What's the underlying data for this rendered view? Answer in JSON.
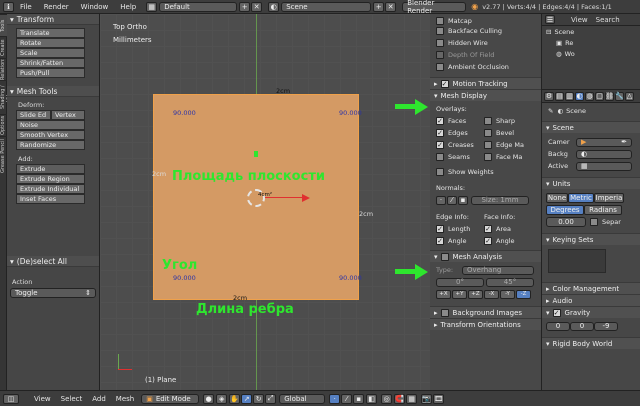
{
  "topbar": {
    "menus": [
      "File",
      "Render",
      "Window",
      "Help"
    ],
    "screen_layout": "Default",
    "scene": "Scene",
    "render_engine": "Blender Render",
    "stats": "v2.77 | Verts:4/4 | Edges:4/4 | Faces:1/1"
  },
  "tooltabs": [
    "Tools",
    "Create",
    "Relations",
    "Shading / UVs",
    "Options",
    "Grease Pencil"
  ],
  "shelf": {
    "transform_title": "Transform",
    "transform_buttons": [
      "Translate",
      "Rotate",
      "Scale",
      "Shrink/Fatten",
      "Push/Pull"
    ],
    "mesh_tools_title": "Mesh Tools",
    "deform_label": "Deform:",
    "slide_edge": "Slide Ed",
    "vertex": "Vertex",
    "deform_buttons": [
      "Noise",
      "Smooth Vertex",
      "Randomize"
    ],
    "add_label": "Add:",
    "add_buttons": [
      "Extrude",
      "Extrude Region",
      "Extrude Individual",
      "Inset Faces"
    ],
    "op_title": "(De)select All",
    "action_label": "Action",
    "action_value": "Toggle"
  },
  "viewport": {
    "view_name": "Top Ortho",
    "units": "Millimeters",
    "object_label": "(1) Plane",
    "edge_top": "2cm",
    "edge_left": "2cm",
    "edge_right": "2cm",
    "edge_bottom": "2cm",
    "angles": [
      "90.000",
      "90.000",
      "90.000",
      "90.000"
    ],
    "face_area": "4cm²",
    "overlay_area": "Площадь плоскости",
    "overlay_angle": "Угол",
    "overlay_length": "Длина ребра"
  },
  "npanel": {
    "top_items": [
      {
        "label": "Matcap",
        "checked": false,
        "dim": false
      },
      {
        "label": "Backface Culling",
        "checked": false,
        "dim": false
      },
      {
        "label": "Hidden Wire",
        "checked": false,
        "dim": false
      },
      {
        "label": "Depth Of Field",
        "checked": false,
        "dim": true
      },
      {
        "label": "Ambient Occlusion",
        "checked": false,
        "dim": false
      }
    ],
    "motion_tracking": "Motion Tracking",
    "mesh_display": "Mesh Display",
    "overlays_label": "Overlays:",
    "overlays": [
      {
        "left": "Faces",
        "left_on": true,
        "right": "Sharp",
        "right_on": false
      },
      {
        "left": "Edges",
        "left_on": true,
        "right": "Bevel",
        "right_on": false
      },
      {
        "left": "Creases",
        "left_on": true,
        "right": "Edge Ma",
        "right_on": false
      },
      {
        "left": "Seams",
        "left_on": false,
        "right": "Face Ma",
        "right_on": false
      }
    ],
    "show_weights": "Show Weights",
    "normals_label": "Normals:",
    "normals_size": "Size: 1mm",
    "edge_info": "Edge Info:",
    "face_info": "Face Info:",
    "length": "Length",
    "area": "Area",
    "angle": "Angle",
    "angle2": "Angle",
    "mesh_analysis": "Mesh Analysis",
    "type_label": "Type:",
    "type_value": "Overhang",
    "range_min": "0°",
    "range_max": "45°",
    "axes": [
      "+X",
      "+Y",
      "+Z",
      "-X",
      "-Y",
      "-Z"
    ],
    "background_images": "Background Images",
    "transform_orientations": "Transform Orientations"
  },
  "outliner": {
    "view": "View",
    "search": "Search",
    "items": [
      "Scene",
      "Re",
      "Wo"
    ]
  },
  "props": {
    "item": "Scene",
    "scene_title": "Scene",
    "camera_label": "Camer",
    "background_label": "Backg",
    "active_label": "Active",
    "units_title": "Units",
    "unit_systems": [
      "None",
      "Metric",
      "Imperia"
    ],
    "angle_units": [
      "Degrees",
      "Radians"
    ],
    "scale_value": "0.00",
    "separate": "Separ",
    "keying_sets": "Keying Sets",
    "color_management": "Color Management",
    "audio": "Audio",
    "gravity": "Gravity",
    "gravity_values": [
      "0",
      "0",
      "-9"
    ],
    "rigid_body": "Rigid Body World"
  },
  "bottombar": {
    "menus": [
      "View",
      "Select",
      "Add",
      "Mesh"
    ],
    "mode": "Edit Mode",
    "orientation": "Global"
  },
  "colors": {
    "plane": "#d49a64",
    "annotation": "#2ee62e",
    "angle_text": "#2c34a8",
    "accent_blue": "#5680c2"
  }
}
